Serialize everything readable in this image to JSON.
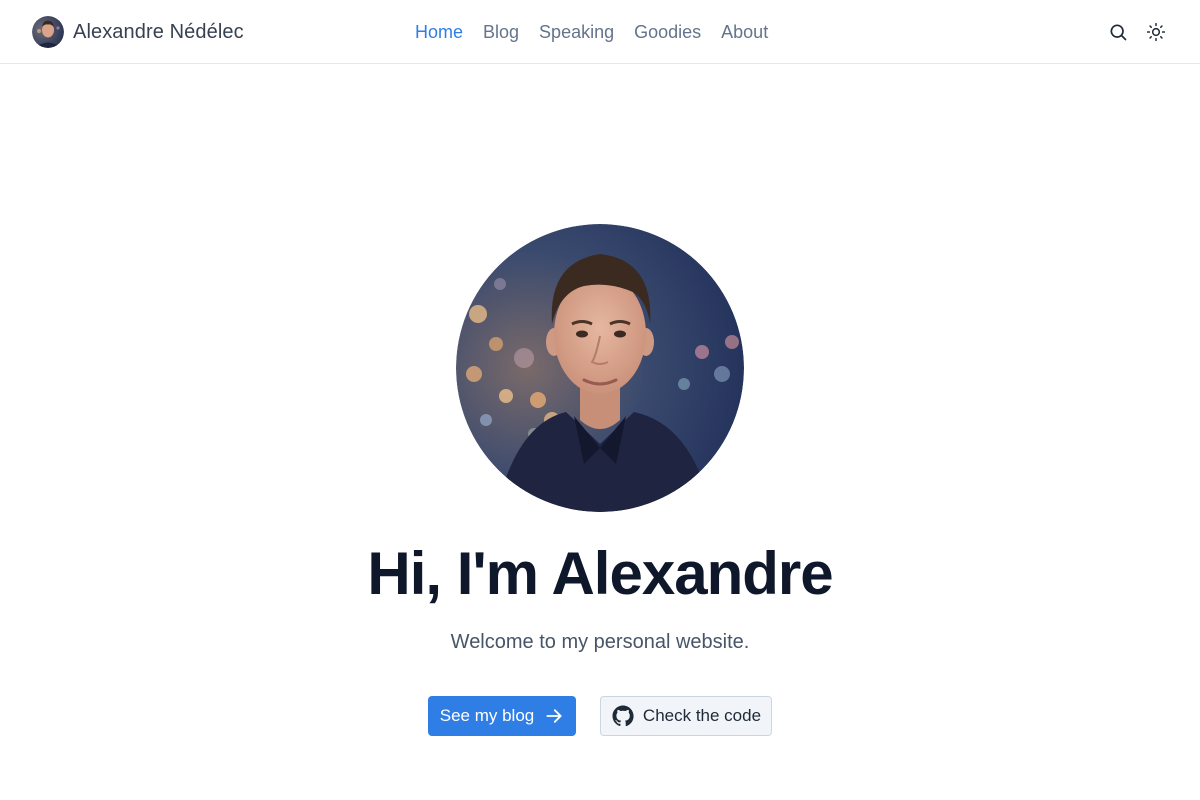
{
  "header": {
    "brand_name": "Alexandre Nédélec",
    "nav": [
      {
        "label": "Home",
        "active": true
      },
      {
        "label": "Blog",
        "active": false
      },
      {
        "label": "Speaking",
        "active": false
      },
      {
        "label": "Goodies",
        "active": false
      },
      {
        "label": "About",
        "active": false
      }
    ],
    "actions": [
      {
        "icon": "search-icon"
      },
      {
        "icon": "sun-icon"
      }
    ]
  },
  "hero": {
    "title": "Hi, I'm Alexandre",
    "subtitle": "Welcome to my personal website.",
    "primary_button": {
      "label": "See my blog",
      "icon": "arrow-right-icon"
    },
    "secondary_button": {
      "label": "Check the code",
      "icon": "github-icon"
    }
  },
  "colors": {
    "accent": "#2f7ee6",
    "nav_text": "#64748b",
    "title": "#0f172a"
  }
}
